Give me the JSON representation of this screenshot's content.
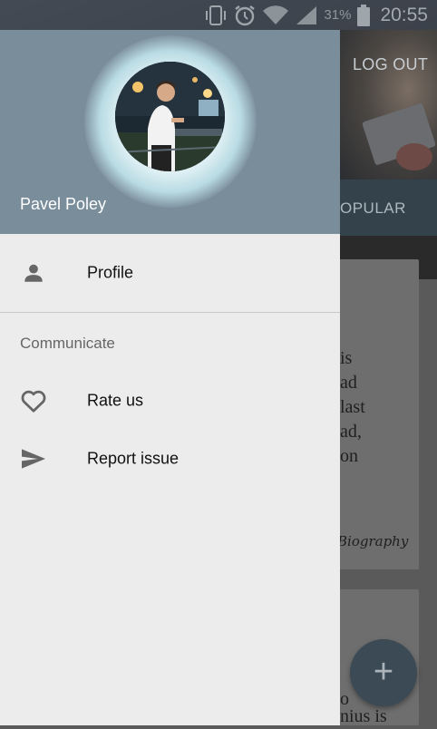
{
  "status_bar": {
    "battery_percent": "31%",
    "time": "20:55",
    "icons": [
      "vibrate-icon",
      "alarm-icon",
      "wifi-icon",
      "signal-icon",
      "battery-icon"
    ]
  },
  "background_app": {
    "logout_label": "LOG OUT",
    "tab_label_partial": "OPULAR",
    "card_lines": [
      "is",
      "ad",
      "last",
      "ad,",
      "on"
    ],
    "card_signature": "Biography",
    "card2_lines": [
      "o",
      "nius is"
    ],
    "fab_icon": "plus-icon"
  },
  "drawer": {
    "user_name": "Pavel Poley",
    "menu": {
      "profile_label": "Profile",
      "section_title": "Communicate",
      "rate_label": "Rate us",
      "report_label": "Report issue"
    }
  },
  "colors": {
    "drawer_header": "#7a8d9b",
    "drawer_background": "#ececec",
    "icon_gray": "#666666"
  }
}
